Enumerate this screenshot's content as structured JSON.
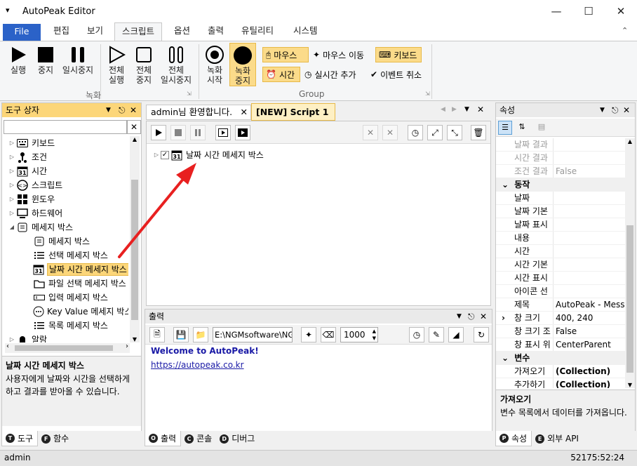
{
  "app": {
    "title": "AutoPeak Editor"
  },
  "menu": {
    "file": "File",
    "tabs": [
      "편집",
      "보기",
      "스크립트",
      "옵션",
      "출력",
      "유틸리티",
      "시스템"
    ]
  },
  "ribbon": {
    "record_group_label": "녹화",
    "group_label": "Group",
    "buttons": {
      "run": "실행",
      "stop": "중지",
      "pause": "일시중지",
      "run_all_1": "전체",
      "run_all_2": "실행",
      "stop_all_1": "전체",
      "stop_all_2": "중지",
      "pause_all_1": "전체",
      "pause_all_2": "일시중지",
      "rec_start_1": "녹화",
      "rec_start_2": "시작",
      "rec_stop_1": "녹화",
      "rec_stop_2": "중지"
    },
    "small": {
      "mouse": "마우스",
      "mouse_move": "마우스 이동",
      "keyboard": "키보드",
      "time": "시간",
      "realtime_add": "실시간 추가",
      "event_cancel": "이벤트 취소"
    }
  },
  "toolbox": {
    "title": "도구 상자",
    "items": [
      {
        "label": "키보드",
        "level": 0,
        "icon": "keyboard-icon"
      },
      {
        "label": "조건",
        "level": 0,
        "icon": "condition-icon"
      },
      {
        "label": "시간",
        "level": 0,
        "icon": "calendar-icon"
      },
      {
        "label": "스크립트",
        "level": 0,
        "icon": "script-icon"
      },
      {
        "label": "윈도우",
        "level": 0,
        "icon": "windows-icon"
      },
      {
        "label": "하드웨어",
        "level": 0,
        "icon": "computer-icon"
      },
      {
        "label": "메세지 박스",
        "level": 0,
        "icon": "messagebox-icon",
        "expanded": true
      },
      {
        "label": "메세지 박스",
        "level": 1,
        "icon": "messagebox-icon"
      },
      {
        "label": "선택 메세지 박스",
        "level": 1,
        "icon": "list-icon"
      },
      {
        "label": "날짜 시간 메세지 박스",
        "level": 1,
        "icon": "calendar-icon",
        "selected": true
      },
      {
        "label": "파일 선택 메세지 박스",
        "level": 1,
        "icon": "folder-icon"
      },
      {
        "label": "입력 메세지 박스",
        "level": 1,
        "icon": "input-icon"
      },
      {
        "label": "Key Value 메세지 박스",
        "level": 1,
        "icon": "keyvalue-icon"
      },
      {
        "label": "목록 메세지 박스",
        "level": 1,
        "icon": "list-icon"
      },
      {
        "label": "알람",
        "level": 0,
        "icon": "bell-icon"
      }
    ],
    "desc_title": "날짜 시간 메세지 박스",
    "desc_text": "사용자에게 날짜와 시간을 선택하게 하고 결과를 받아올 수 있습니다.",
    "bottom_tabs": [
      {
        "letter": "T",
        "label": "도구"
      },
      {
        "letter": "F",
        "label": "함수"
      }
    ]
  },
  "editor": {
    "tabs": [
      {
        "label": "admin님 환영합니다."
      },
      {
        "label": "[NEW] Script 1"
      }
    ],
    "tree_item": "날짜 시간 메세지 박스"
  },
  "output": {
    "title": "출력",
    "path": "E:\\NGMsoftware\\NG",
    "count": "1000",
    "line1": "Welcome to AutoPeak!",
    "line2": "https://autopeak.co.kr",
    "bottom_tabs": [
      {
        "letter": "O",
        "label": "출력"
      },
      {
        "letter": "C",
        "label": "콘솔"
      },
      {
        "letter": "D",
        "label": "디버그"
      }
    ]
  },
  "properties": {
    "title": "속성",
    "rows": [
      {
        "type": "row",
        "k": "날짜 결과",
        "v": "",
        "gray": true
      },
      {
        "type": "row",
        "k": "시간 결과",
        "v": "",
        "gray": true
      },
      {
        "type": "row",
        "k": "조건 결과",
        "v": "False",
        "gray": true
      },
      {
        "type": "cat",
        "k": "동작"
      },
      {
        "type": "row",
        "k": "날짜",
        "v": ""
      },
      {
        "type": "row",
        "k": "날짜 기본",
        "v": ""
      },
      {
        "type": "row",
        "k": "날짜 표시",
        "v": ""
      },
      {
        "type": "row",
        "k": "내용",
        "v": ""
      },
      {
        "type": "row",
        "k": "시간",
        "v": ""
      },
      {
        "type": "row",
        "k": "시간 기본",
        "v": ""
      },
      {
        "type": "row",
        "k": "시간 표시",
        "v": ""
      },
      {
        "type": "row",
        "k": "아이콘 선",
        "v": ""
      },
      {
        "type": "row",
        "k": "제목",
        "v": "AutoPeak - Messa"
      },
      {
        "type": "row",
        "k": "창 크기",
        "v": "400, 240",
        "expand": true
      },
      {
        "type": "row",
        "k": "창 크기 조",
        "v": "False"
      },
      {
        "type": "row",
        "k": "창 표시 위",
        "v": "CenterParent"
      },
      {
        "type": "cat",
        "k": "변수"
      },
      {
        "type": "row",
        "k": "가져오기",
        "v": "(Collection)",
        "bold": true
      },
      {
        "type": "row",
        "k": "추가하기",
        "v": "(Collection)",
        "bold": true
      }
    ],
    "desc_title": "가져오기",
    "desc_text": "변수 목록에서 데이터를 가져옵니다.",
    "bottom_tabs": [
      {
        "letter": "P",
        "label": "속성"
      },
      {
        "letter": "E",
        "label": "외부 API"
      }
    ]
  },
  "status": {
    "left": "admin",
    "right": "52175:52:24"
  }
}
